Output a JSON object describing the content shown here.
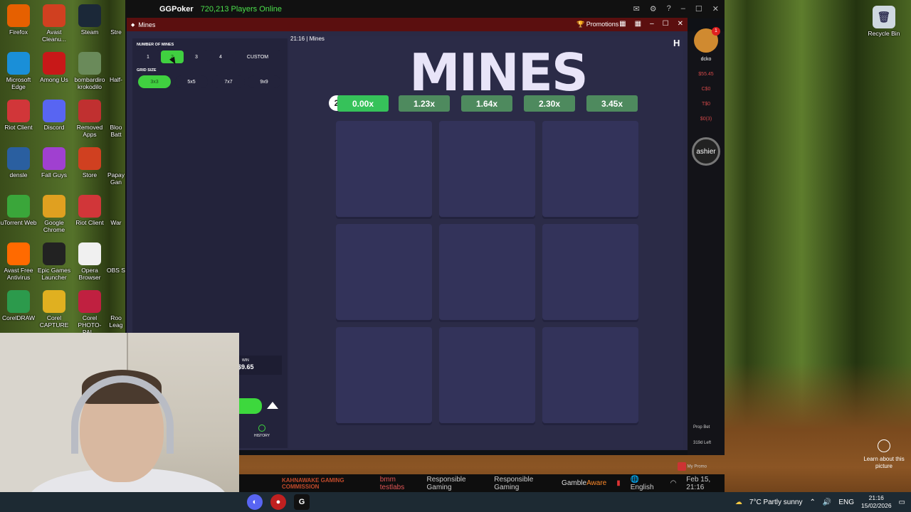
{
  "desktop": {
    "icons": [
      {
        "label": "Firefox",
        "color": "#e66000"
      },
      {
        "label": "Avast Cleanu...",
        "color": "#d04020"
      },
      {
        "label": "Steam",
        "color": "#1b2838"
      },
      {
        "label": "Microsoft Edge",
        "color": "#1a8fd8"
      },
      {
        "label": "Among Us",
        "color": "#c81818"
      },
      {
        "label": "bombardiro krokodilo",
        "color": "#6a8a5a"
      },
      {
        "label": "Riot Client",
        "color": "#d13639"
      },
      {
        "label": "Discord",
        "color": "#5865f2"
      },
      {
        "label": "Removed Apps",
        "color": "#c03030"
      },
      {
        "label": "densle",
        "color": "#2a5fa0"
      },
      {
        "label": "Fall Guys",
        "color": "#a040d0"
      },
      {
        "label": "Store",
        "color": "#d04020"
      },
      {
        "label": "uTorrent Web",
        "color": "#3aa63a"
      },
      {
        "label": "Google Chrome",
        "color": "#e0a020"
      },
      {
        "label": "Riot Client",
        "color": "#d13639"
      },
      {
        "label": "Avast Free Antivirus",
        "color": "#ff6a00"
      },
      {
        "label": "Epic Games Launcher",
        "color": "#222222"
      },
      {
        "label": "Opera Browser",
        "color": "#f0f0f0"
      },
      {
        "label": "CorelDRAW",
        "color": "#2c9a4c"
      },
      {
        "label": "Corel CAPTURE",
        "color": "#e0b020"
      },
      {
        "label": "Corel PHOTO-PAI...",
        "color": "#c02040"
      }
    ],
    "partial_labels": [
      "Stre",
      "Half-",
      "Bloo Batt",
      "Papay Gan",
      "War",
      "OBS S",
      "Roo Leag"
    ],
    "recycle_bin": "Recycle Bin",
    "learn_more": "Learn about this picture"
  },
  "client": {
    "app_name": "GGPoker",
    "players_online": "720,213 Players Online",
    "side_values": [
      "$55.45",
      "C$0",
      "T$0",
      "$0(3)"
    ],
    "cashier": "ashier",
    "prop_bet": "Prop Bet",
    "left_label": "319d Left",
    "my_promo": "My Promo",
    "user_short": "dcko",
    "notification_count": "1"
  },
  "mines_window": {
    "title": "Mines",
    "promotions": "Promotions",
    "time": "21:16",
    "game_name": "Mines",
    "logo": "MINES",
    "number_of_mines_label": "NUMBER OF MINES",
    "mine_options": [
      "1",
      "2",
      "3",
      "4",
      "CUSTOM"
    ],
    "selected_mines": "2",
    "grid_size_label": "GRID SIZE",
    "grid_options": [
      "3x3",
      "5x5",
      "7x7",
      "9x9"
    ],
    "selected_grid": "3x3",
    "win_label": "WIN",
    "win_value": "$9.65",
    "history_label": "HISTORY",
    "mine_count_badge": "2",
    "multipliers": [
      "0.00x",
      "1.23x",
      "1.64x",
      "2.30x",
      "3.45x"
    ]
  },
  "footer": {
    "kahnawake": "KAHNAWAKE GAMING COMMISSION",
    "bmm": "bmm testlabs",
    "responsible1": "Responsible Gaming",
    "responsible2": "Responsible Gaming",
    "gamble_a": "Gamble",
    "gamble_b": "Aware",
    "language": "English",
    "date": "Feb 15, 21:16"
  },
  "taskbar": {
    "weather": "7°C  Partly sunny",
    "lang": "ENG",
    "time": "21:16",
    "date": "15/02/2026"
  }
}
